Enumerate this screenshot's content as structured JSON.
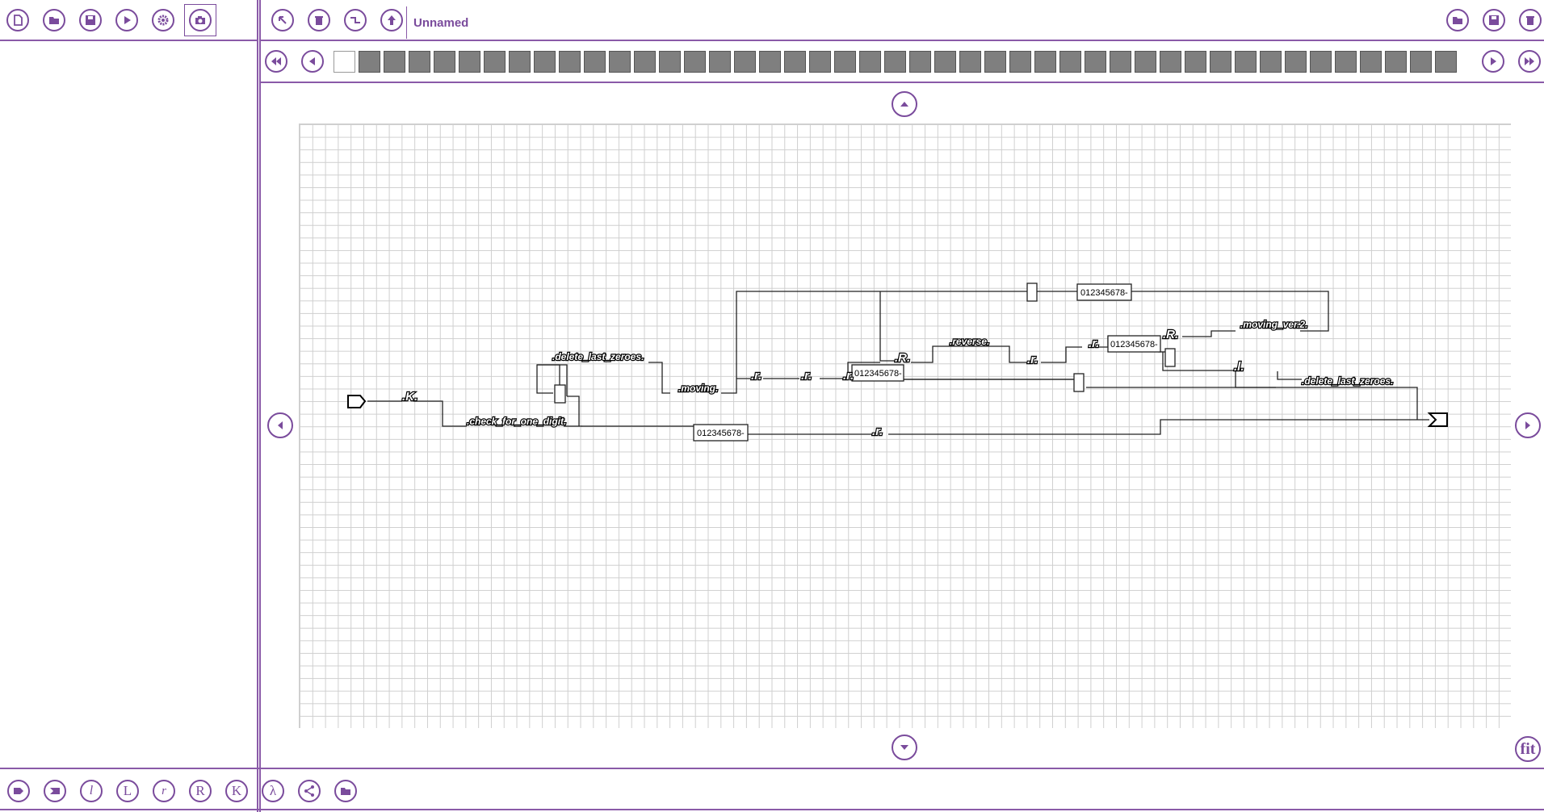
{
  "app": {
    "title": "Unnamed"
  },
  "left_toolbar": [
    {
      "name": "new-file-icon",
      "label": ""
    },
    {
      "name": "open-folder-icon",
      "label": ""
    },
    {
      "name": "save-icon",
      "label": ""
    },
    {
      "name": "run-play-icon",
      "label": ""
    },
    {
      "name": "settings-gear-icon",
      "label": ""
    },
    {
      "name": "camera-icon",
      "label": ""
    }
  ],
  "main_toolbar": [
    {
      "name": "select-arrow-icon"
    },
    {
      "name": "trash-icon"
    },
    {
      "name": "wire-route-icon"
    },
    {
      "name": "upload-icon"
    }
  ],
  "right_toolbar": [
    {
      "name": "open-folder-icon"
    },
    {
      "name": "save-icon"
    },
    {
      "name": "trash-icon"
    }
  ],
  "tabs": {
    "count": 45,
    "active_index": 0
  },
  "canvas": {
    "labels": [
      ".delete_last_zeroes.",
      ".moving.",
      ".check_for_one_digit.",
      ".K.",
      ".r.",
      ".r.",
      ".r.",
      ".R.",
      ".reverse.",
      ".r.",
      ".r.",
      ".R.",
      ".moving_ver.2.",
      ".l.",
      ".delete_last_zeroes.",
      ".r."
    ],
    "boxes": [
      "012345678-",
      "012345678-",
      "012345678-",
      "012345678-"
    ]
  },
  "bottom_toolbar": [
    {
      "name": "start-node-icon",
      "glyph": ""
    },
    {
      "name": "end-node-icon",
      "glyph": ""
    },
    {
      "name": "script-l-icon",
      "glyph": "l"
    },
    {
      "name": "move-left-L-icon",
      "glyph": "L"
    },
    {
      "name": "rewind-r-icon",
      "glyph": "r"
    },
    {
      "name": "move-right-R-icon",
      "glyph": "R"
    },
    {
      "name": "K-icon",
      "glyph": "K"
    },
    {
      "name": "lambda-icon",
      "glyph": "λ"
    },
    {
      "name": "share-icon",
      "glyph": ""
    },
    {
      "name": "folder-icon",
      "glyph": ""
    }
  ],
  "fit_label": "fit"
}
